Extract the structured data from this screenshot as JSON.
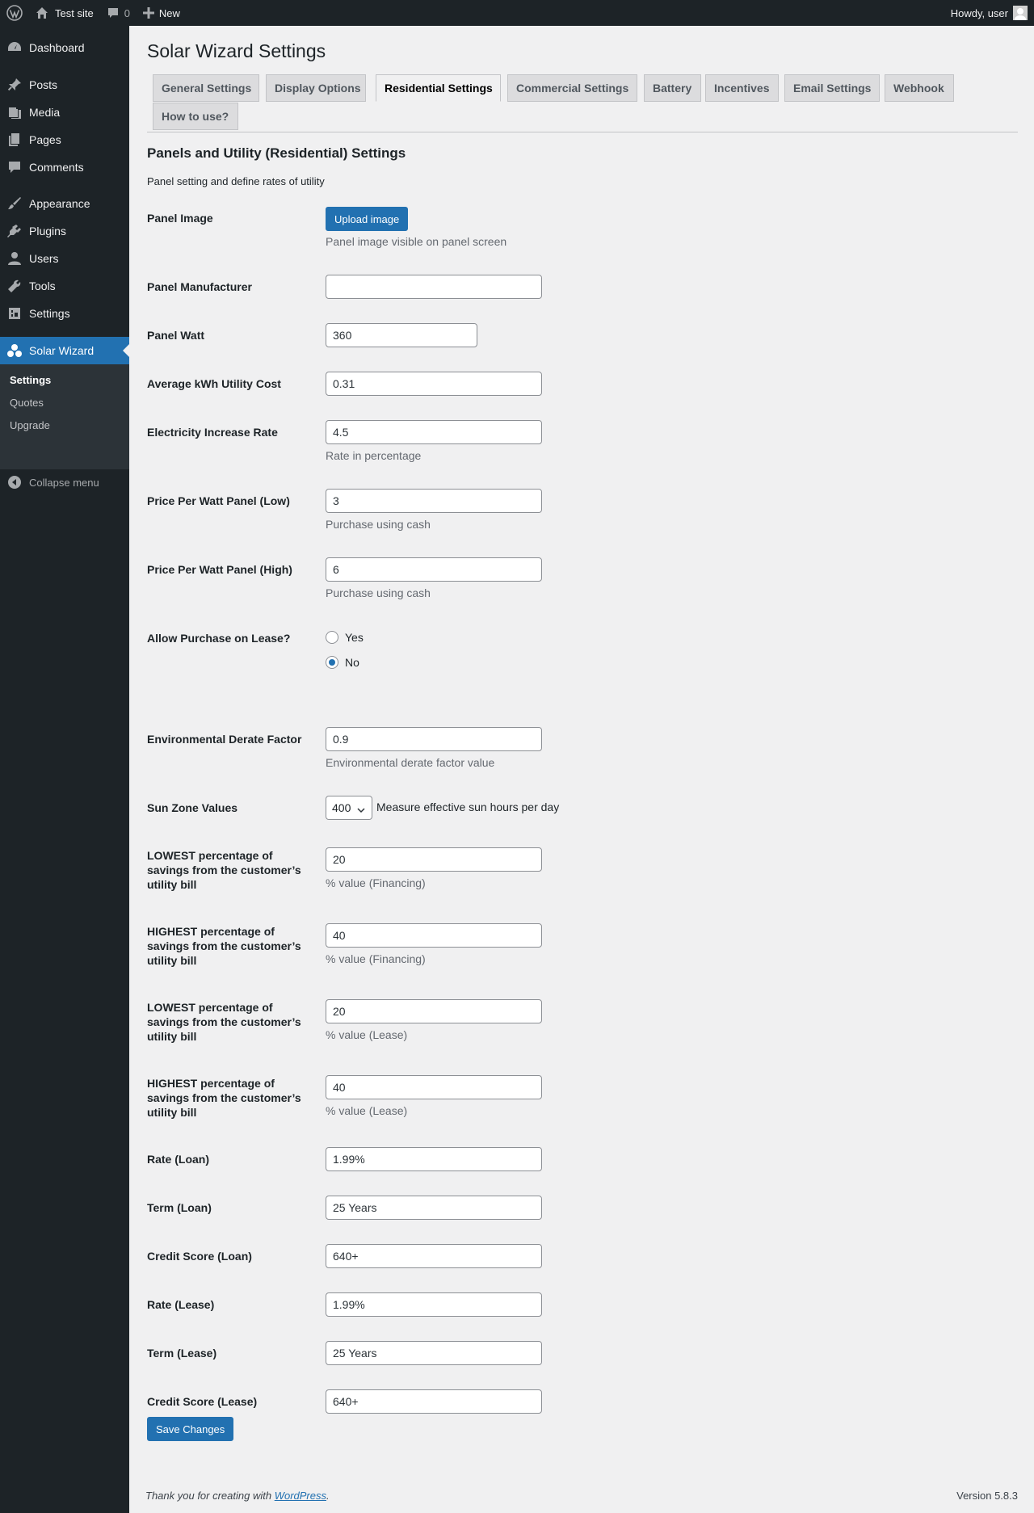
{
  "adminbar": {
    "site_name": "Test site",
    "comments_count": "0",
    "new_label": "New",
    "howdy": "Howdy, user"
  },
  "sidebar": {
    "items": [
      {
        "label": "Dashboard",
        "icon": "dashboard-icon"
      },
      {
        "label": "Posts",
        "icon": "pin-icon"
      },
      {
        "label": "Media",
        "icon": "media-icon"
      },
      {
        "label": "Pages",
        "icon": "pages-icon"
      },
      {
        "label": "Comments",
        "icon": "comment-icon"
      },
      {
        "label": "Appearance",
        "icon": "paintbrush-icon"
      },
      {
        "label": "Plugins",
        "icon": "plugin-icon"
      },
      {
        "label": "Users",
        "icon": "users-icon"
      },
      {
        "label": "Tools",
        "icon": "wrench-icon"
      },
      {
        "label": "Settings",
        "icon": "settings-icon"
      },
      {
        "label": "Solar Wizard",
        "icon": "solar-wizard-icon"
      }
    ],
    "submenu": [
      "Settings",
      "Quotes",
      "Upgrade"
    ],
    "collapse": "Collapse menu"
  },
  "page": {
    "title": "Solar Wizard Settings",
    "tabs": [
      "General Settings",
      "Display Options",
      "Residential Settings",
      "Commercial Settings",
      "Battery",
      "Incentives",
      "Email Settings",
      "Webhook",
      "How to use?"
    ],
    "active_tab": "Residential Settings",
    "section_title": "Panels and Utility (Residential) Settings",
    "section_desc": "Panel setting and define rates of utility"
  },
  "form": {
    "panel_image": {
      "label": "Panel Image",
      "button": "Upload image",
      "desc": "Panel image visible on panel screen"
    },
    "panel_manufacturer": {
      "label": "Panel Manufacturer",
      "value": ""
    },
    "panel_watt": {
      "label": "Panel Watt",
      "value": "360"
    },
    "avg_kwh_cost": {
      "label": "Average kWh Utility Cost",
      "value": "0.31"
    },
    "electricity_increase": {
      "label": "Electricity Increase Rate",
      "value": "4.5",
      "desc": "Rate in percentage"
    },
    "ppw_low": {
      "label": "Price Per Watt Panel (Low)",
      "value": "3",
      "desc": "Purchase using cash"
    },
    "ppw_high": {
      "label": "Price Per Watt Panel (High)",
      "value": "6",
      "desc": "Purchase using cash"
    },
    "allow_lease": {
      "label": "Allow Purchase on Lease?",
      "options": [
        "Yes",
        "No"
      ],
      "selected": "No"
    },
    "derate": {
      "label": "Environmental Derate Factor",
      "value": "0.9",
      "desc": "Environmental derate factor value"
    },
    "sun_zone": {
      "label": "Sun Zone Values",
      "value": "400",
      "desc": "Measure effective sun hours per day"
    },
    "low_fin": {
      "label": "LOWEST percentage of savings from the customer’s utility bill",
      "value": "20",
      "desc": "% value (Financing)"
    },
    "high_fin": {
      "label": "HIGHEST percentage of savings from the customer’s utility bill",
      "value": "40",
      "desc": "% value (Financing)"
    },
    "low_lease": {
      "label": "LOWEST percentage of savings from the customer’s utility bill",
      "value": "20",
      "desc": "% value (Lease)"
    },
    "high_lease": {
      "label": "HIGHEST percentage of savings from the customer’s utility bill",
      "value": "40",
      "desc": "% value (Lease)"
    },
    "rate_loan": {
      "label": "Rate (Loan)",
      "value": "1.99%"
    },
    "term_loan": {
      "label": "Term (Loan)",
      "value": "25 Years"
    },
    "credit_loan": {
      "label": "Credit Score (Loan)",
      "value": "640+"
    },
    "rate_lease": {
      "label": "Rate (Lease)",
      "value": "1.99%"
    },
    "term_lease": {
      "label": "Term (Lease)",
      "value": "25 Years"
    },
    "credit_lease": {
      "label": "Credit Score (Lease)",
      "value": "640+"
    },
    "save": "Save Changes"
  },
  "footer": {
    "thanks_prefix": "Thank you for creating with ",
    "thanks_link": "WordPress",
    "thanks_suffix": ".",
    "version": "Version 5.8.3"
  },
  "colors": {
    "accent": "#2271b1",
    "sidebar": "#1d2327",
    "background": "#f0f0f1"
  }
}
